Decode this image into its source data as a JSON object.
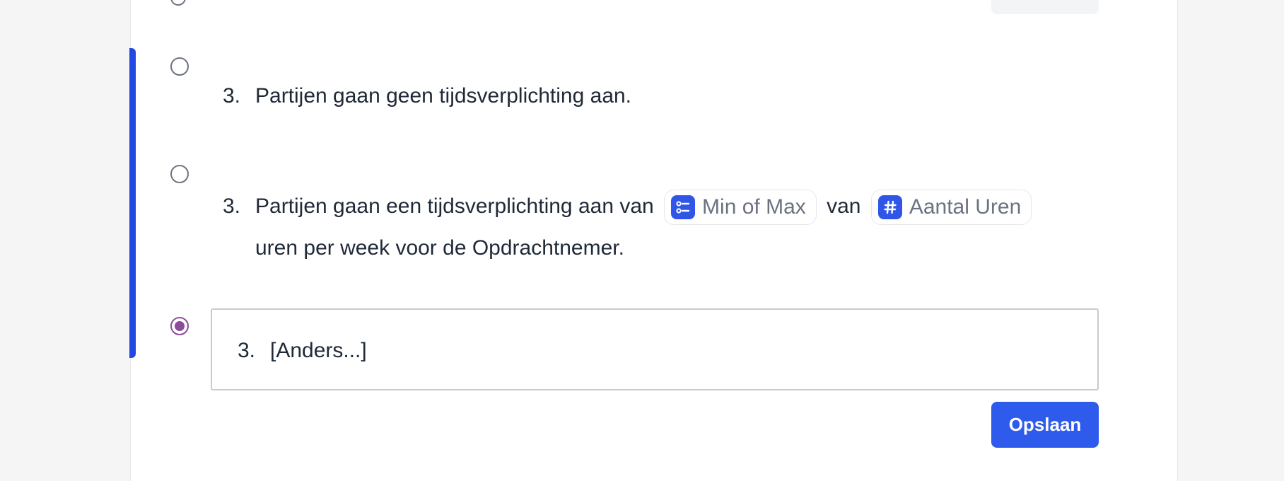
{
  "colors": {
    "accent_bar": "#2148e0",
    "selected_radio": "#8b4c9a",
    "primary_button": "#2f5bed",
    "chip_icon_bg": "#2f56e6"
  },
  "options": [
    {
      "selected": false,
      "number": "3.",
      "text": "Partijen gaan geen tijdsverplichting aan."
    },
    {
      "selected": false,
      "number": "3.",
      "text_before": "Partijen gaan een tijdsverplichting aan van",
      "chip1": {
        "icon": "list-icon",
        "label": "Min of Max"
      },
      "text_middle": "van",
      "chip2": {
        "icon": "hash-icon",
        "label": "Aantal Uren"
      },
      "text_after": "uren per week voor de Opdrachtnemer."
    },
    {
      "selected": true,
      "number": "3.",
      "text": "[Anders...]"
    }
  ],
  "actions": {
    "save_label": "Opslaan"
  }
}
